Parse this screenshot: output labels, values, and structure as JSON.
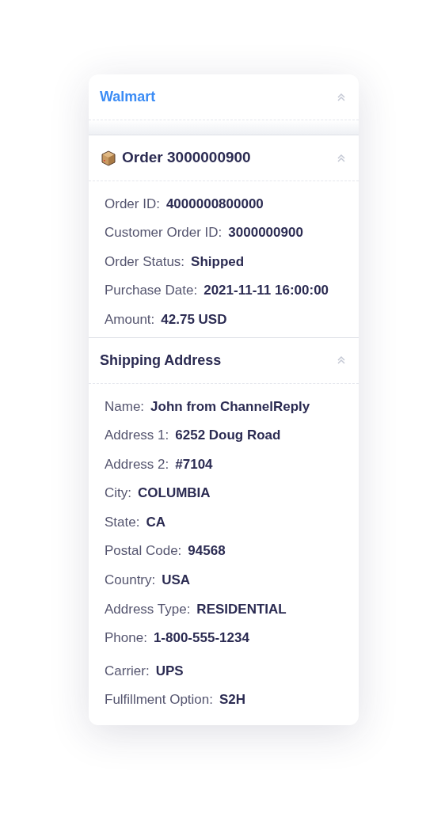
{
  "sections": [
    {
      "kind": "store",
      "title": "Walmart",
      "expanded": true
    },
    {
      "kind": "order",
      "title": "Order 3000000900",
      "expanded": true,
      "fields": [
        {
          "label": "Order ID:",
          "value": "4000000800000"
        },
        {
          "label": "Customer Order ID:",
          "value": "3000000900"
        },
        {
          "label": "Order Status:",
          "value": "Shipped"
        },
        {
          "label": "Purchase Date:",
          "value": "2021-11-11 16:00:00"
        },
        {
          "label": "Amount:",
          "value": "42.75 USD"
        }
      ]
    },
    {
      "kind": "group",
      "title": "Shipping Address",
      "expanded": true,
      "fields": [
        {
          "label": "Name:",
          "value": "John from ChannelReply"
        },
        {
          "label": "Address 1:",
          "value": "6252 Doug Road"
        },
        {
          "label": "Address 2:",
          "value": "#7104"
        },
        {
          "label": "City:",
          "value": "COLUMBIA"
        },
        {
          "label": "State:",
          "value": "CA"
        },
        {
          "label": "Postal Code:",
          "value": "94568"
        },
        {
          "label": "Country:",
          "value": "USA"
        },
        {
          "label": "Address Type:",
          "value": "RESIDENTIAL"
        },
        {
          "label": "Phone:",
          "value": "1-800-555-1234"
        },
        {
          "label": "Carrier:",
          "value": "UPS"
        },
        {
          "label": "Fulfillment Option:",
          "value": "S2H"
        }
      ]
    }
  ]
}
